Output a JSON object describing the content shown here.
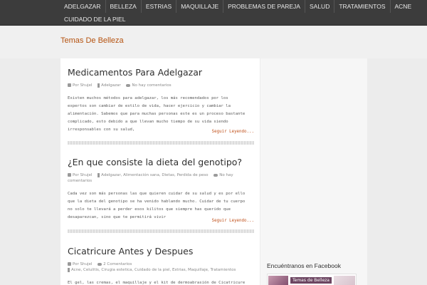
{
  "nav": {
    "row1": [
      "ADELGAZAR",
      "BELLEZA",
      "ESTRIAS",
      "MAQUILLAJE",
      "PROBLEMAS DE PAREJA",
      "SALUD",
      "TRATAMIENTOS",
      "ACNE"
    ],
    "row2": [
      "CUIDADO DE LA PIEL"
    ]
  },
  "site": {
    "title": "Temas De Belleza"
  },
  "posts": [
    {
      "title": "Medicamentos Para Adelgazar",
      "author": "Por Shujel",
      "categories": "Adelgazar",
      "comments": "No hay comentarios",
      "excerpt": "Existen muchos métodos para adelgazar, los más recomendados por los\nexpertos son cambiar de estilo de vida, hacer ejercicio y cambiar la\nalimentación. Sabemos que para muchas personas este es un proceso bastante\ncomplicado, esto debido a que llevan mucho tiempo de su vida siendo\nirresponsables con su salud,",
      "read_more": "Seguir Leyendo..."
    },
    {
      "title": "¿En que consiste la dieta del genotipo?",
      "author": "Por Shujel",
      "categories": "Adelgazar, Alimentación sana, Dietas, Perdida de peso",
      "comments": "No hay comentarios",
      "excerpt": "Cada vez son más personas las que quieren cuidar de su salud y es por ello\nque la dieta del genotipo se ha venido hablando mucho. Cuidar de tu cuerpo\nno solo te llevará a perder esos kilitos que siempre has querido que\ndesaparezcan, sino que te permitirá vivir",
      "read_more": "Seguir Leyendo..."
    },
    {
      "title": "Cicatricure Antes y Despues",
      "author": "Por Shujel",
      "categories": "Acne, Celulitis, Cirugia estetica, Cuidado de la piel, Estrias, Maquillaje, Tratamientos",
      "comments": "2 Comentarios",
      "excerpt": "El gel, las cremas, el maquillaje y el kit de dermoabrasión de Cicatricure"
    }
  ],
  "sidebar": {
    "widget_title": "Encuéntranos en Facebook",
    "fb_page_name": "Temas de Belleza"
  }
}
